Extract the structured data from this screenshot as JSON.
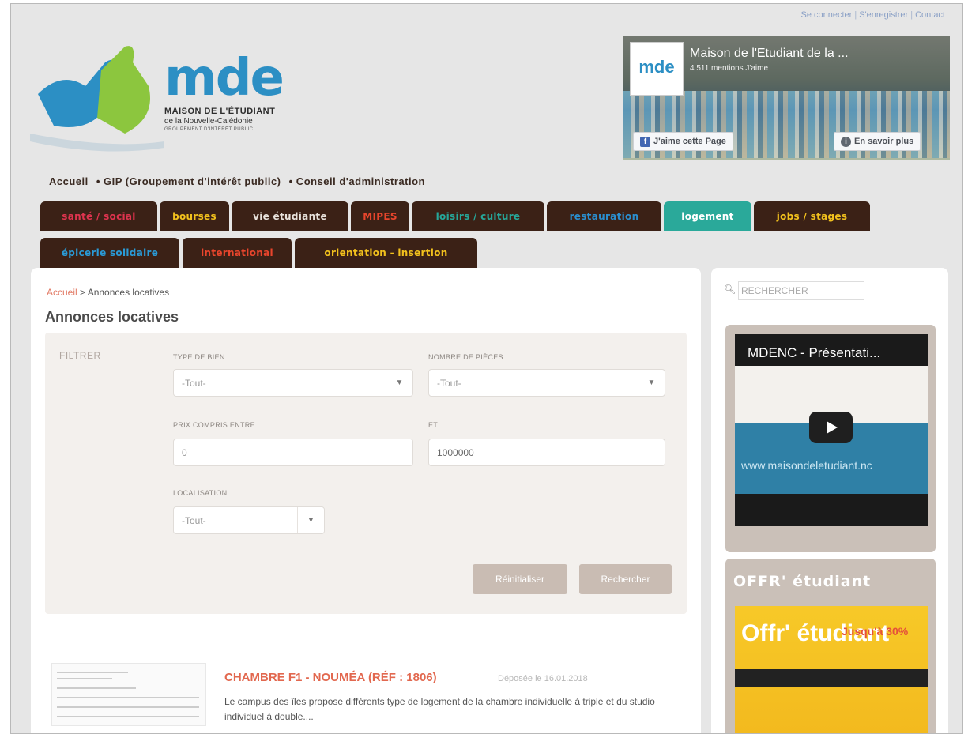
{
  "top_links": [
    "Se connecter",
    "S'enregistrer",
    "Contact"
  ],
  "logo": {
    "brand": "mde",
    "line1": "MAISON DE L'ÉTUDIANT",
    "line2": "de la Nouvelle-Calédonie",
    "line3": "GROUPEMENT D'INTÉRÊT PUBLIC"
  },
  "facebook": {
    "page_name": "Maison de l'Etudiant de la ...",
    "likes": "4 511 mentions J'aime",
    "like_button": "J'aime cette Page",
    "more_button": "En savoir plus"
  },
  "primary_nav": [
    "Accueil",
    "• GIP (Groupement d'intérêt public)",
    "• Conseil d'administration"
  ],
  "tabs": [
    {
      "label": "santé / social",
      "color": "#e0344f"
    },
    {
      "label": "bourses",
      "color": "#f2c11d"
    },
    {
      "label": "vie étudiante",
      "color": "#e8e2dc"
    },
    {
      "label": "MIPES",
      "color": "#e8452c"
    },
    {
      "label": "loisirs / culture",
      "color": "#26a89b"
    },
    {
      "label": "restauration",
      "color": "#2a8fd0"
    },
    {
      "label": "logement",
      "color": "#ffffff"
    },
    {
      "label": "jobs / stages",
      "color": "#f2c11d"
    },
    {
      "label": "épicerie solidaire",
      "color": "#2a9ad6"
    },
    {
      "label": "international",
      "color": "#e8452c"
    },
    {
      "label": "orientation - insertion",
      "color": "#f2c11d"
    }
  ],
  "breadcrumb": {
    "home": "Accueil",
    "sep": " > ",
    "current": "Annonces locatives"
  },
  "page_title": "Annonces locatives",
  "filter": {
    "label": "FILTRER",
    "type_label": "TYPE DE BIEN",
    "type_value": "-Tout-",
    "rooms_label": "NOMBRE DE PIÈCES",
    "rooms_value": "-Tout-",
    "price_label": "PRIX COMPRIS ENTRE",
    "price_min": "0",
    "and_label": "ET",
    "price_max": "1000000",
    "loc_label": "LOCALISATION",
    "loc_value": "-Tout-",
    "reset_button": "Réinitialiser",
    "search_button": "Rechercher"
  },
  "listing": {
    "title": "CHAMBRE F1 - NOUMÉA (RÉF : 1806)",
    "date": "Déposée le 16.01.2018",
    "description": "Le campus des îles propose différents type de logement de la chambre individuelle à triple et du studio individuel à double...."
  },
  "sidebar": {
    "search_placeholder": "RECHERCHER",
    "video_title": "MDENC - Présentati...",
    "video_url": "www.maisondeletudiant.nc",
    "offer_title": "OFFR' étudiant",
    "offer_image_text": "Offr' étudiant",
    "offer_pct": "Jusqu'à 30%"
  }
}
